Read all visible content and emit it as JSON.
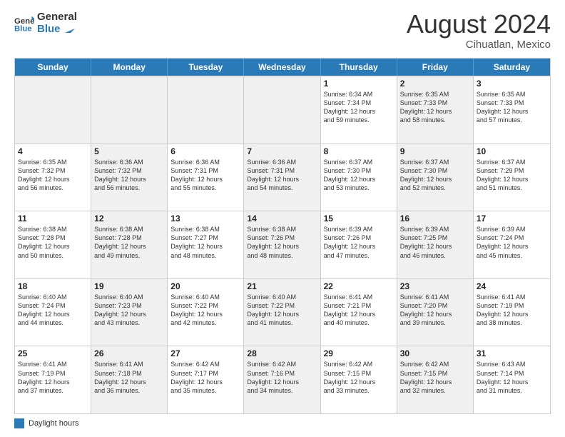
{
  "header": {
    "logo_line1": "General",
    "logo_line2": "Blue",
    "month": "August 2024",
    "location": "Cihuatlan, Mexico"
  },
  "days_of_week": [
    "Sunday",
    "Monday",
    "Tuesday",
    "Wednesday",
    "Thursday",
    "Friday",
    "Saturday"
  ],
  "weeks": [
    [
      {
        "day": "",
        "info": "",
        "shaded": true
      },
      {
        "day": "",
        "info": "",
        "shaded": true
      },
      {
        "day": "",
        "info": "",
        "shaded": true
      },
      {
        "day": "",
        "info": "",
        "shaded": true
      },
      {
        "day": "1",
        "info": "Sunrise: 6:34 AM\nSunset: 7:34 PM\nDaylight: 12 hours\nand 59 minutes.",
        "shaded": false
      },
      {
        "day": "2",
        "info": "Sunrise: 6:35 AM\nSunset: 7:33 PM\nDaylight: 12 hours\nand 58 minutes.",
        "shaded": true
      },
      {
        "day": "3",
        "info": "Sunrise: 6:35 AM\nSunset: 7:33 PM\nDaylight: 12 hours\nand 57 minutes.",
        "shaded": false
      }
    ],
    [
      {
        "day": "4",
        "info": "Sunrise: 6:35 AM\nSunset: 7:32 PM\nDaylight: 12 hours\nand 56 minutes.",
        "shaded": false
      },
      {
        "day": "5",
        "info": "Sunrise: 6:36 AM\nSunset: 7:32 PM\nDaylight: 12 hours\nand 56 minutes.",
        "shaded": true
      },
      {
        "day": "6",
        "info": "Sunrise: 6:36 AM\nSunset: 7:31 PM\nDaylight: 12 hours\nand 55 minutes.",
        "shaded": false
      },
      {
        "day": "7",
        "info": "Sunrise: 6:36 AM\nSunset: 7:31 PM\nDaylight: 12 hours\nand 54 minutes.",
        "shaded": true
      },
      {
        "day": "8",
        "info": "Sunrise: 6:37 AM\nSunset: 7:30 PM\nDaylight: 12 hours\nand 53 minutes.",
        "shaded": false
      },
      {
        "day": "9",
        "info": "Sunrise: 6:37 AM\nSunset: 7:30 PM\nDaylight: 12 hours\nand 52 minutes.",
        "shaded": true
      },
      {
        "day": "10",
        "info": "Sunrise: 6:37 AM\nSunset: 7:29 PM\nDaylight: 12 hours\nand 51 minutes.",
        "shaded": false
      }
    ],
    [
      {
        "day": "11",
        "info": "Sunrise: 6:38 AM\nSunset: 7:28 PM\nDaylight: 12 hours\nand 50 minutes.",
        "shaded": false
      },
      {
        "day": "12",
        "info": "Sunrise: 6:38 AM\nSunset: 7:28 PM\nDaylight: 12 hours\nand 49 minutes.",
        "shaded": true
      },
      {
        "day": "13",
        "info": "Sunrise: 6:38 AM\nSunset: 7:27 PM\nDaylight: 12 hours\nand 48 minutes.",
        "shaded": false
      },
      {
        "day": "14",
        "info": "Sunrise: 6:38 AM\nSunset: 7:26 PM\nDaylight: 12 hours\nand 48 minutes.",
        "shaded": true
      },
      {
        "day": "15",
        "info": "Sunrise: 6:39 AM\nSunset: 7:26 PM\nDaylight: 12 hours\nand 47 minutes.",
        "shaded": false
      },
      {
        "day": "16",
        "info": "Sunrise: 6:39 AM\nSunset: 7:25 PM\nDaylight: 12 hours\nand 46 minutes.",
        "shaded": true
      },
      {
        "day": "17",
        "info": "Sunrise: 6:39 AM\nSunset: 7:24 PM\nDaylight: 12 hours\nand 45 minutes.",
        "shaded": false
      }
    ],
    [
      {
        "day": "18",
        "info": "Sunrise: 6:40 AM\nSunset: 7:24 PM\nDaylight: 12 hours\nand 44 minutes.",
        "shaded": false
      },
      {
        "day": "19",
        "info": "Sunrise: 6:40 AM\nSunset: 7:23 PM\nDaylight: 12 hours\nand 43 minutes.",
        "shaded": true
      },
      {
        "day": "20",
        "info": "Sunrise: 6:40 AM\nSunset: 7:22 PM\nDaylight: 12 hours\nand 42 minutes.",
        "shaded": false
      },
      {
        "day": "21",
        "info": "Sunrise: 6:40 AM\nSunset: 7:22 PM\nDaylight: 12 hours\nand 41 minutes.",
        "shaded": true
      },
      {
        "day": "22",
        "info": "Sunrise: 6:41 AM\nSunset: 7:21 PM\nDaylight: 12 hours\nand 40 minutes.",
        "shaded": false
      },
      {
        "day": "23",
        "info": "Sunrise: 6:41 AM\nSunset: 7:20 PM\nDaylight: 12 hours\nand 39 minutes.",
        "shaded": true
      },
      {
        "day": "24",
        "info": "Sunrise: 6:41 AM\nSunset: 7:19 PM\nDaylight: 12 hours\nand 38 minutes.",
        "shaded": false
      }
    ],
    [
      {
        "day": "25",
        "info": "Sunrise: 6:41 AM\nSunset: 7:19 PM\nDaylight: 12 hours\nand 37 minutes.",
        "shaded": false
      },
      {
        "day": "26",
        "info": "Sunrise: 6:41 AM\nSunset: 7:18 PM\nDaylight: 12 hours\nand 36 minutes.",
        "shaded": true
      },
      {
        "day": "27",
        "info": "Sunrise: 6:42 AM\nSunset: 7:17 PM\nDaylight: 12 hours\nand 35 minutes.",
        "shaded": false
      },
      {
        "day": "28",
        "info": "Sunrise: 6:42 AM\nSunset: 7:16 PM\nDaylight: 12 hours\nand 34 minutes.",
        "shaded": true
      },
      {
        "day": "29",
        "info": "Sunrise: 6:42 AM\nSunset: 7:15 PM\nDaylight: 12 hours\nand 33 minutes.",
        "shaded": false
      },
      {
        "day": "30",
        "info": "Sunrise: 6:42 AM\nSunset: 7:15 PM\nDaylight: 12 hours\nand 32 minutes.",
        "shaded": true
      },
      {
        "day": "31",
        "info": "Sunrise: 6:43 AM\nSunset: 7:14 PM\nDaylight: 12 hours\nand 31 minutes.",
        "shaded": false
      }
    ]
  ],
  "footer": {
    "legend_label": "Daylight hours"
  }
}
